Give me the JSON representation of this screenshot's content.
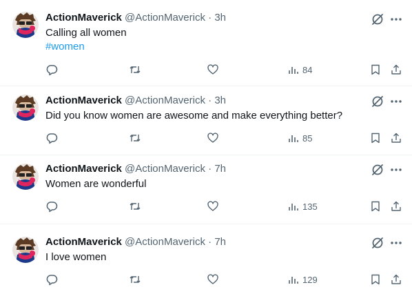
{
  "colors": {
    "link": "#1d9bf0",
    "secondary": "#536471",
    "text": "#0f1419",
    "divider": "#eff3f4"
  },
  "tweets": [
    {
      "name": "ActionMaverick",
      "handle": "@ActionMaverick",
      "sep": "·",
      "time": "3h",
      "text": "Calling all women",
      "hashtag": "#women",
      "views": "84"
    },
    {
      "name": "ActionMaverick",
      "handle": "@ActionMaverick",
      "sep": "·",
      "time": "3h",
      "text": "Did you know women are awesome and make everything better?",
      "views": "85"
    },
    {
      "name": "ActionMaverick",
      "handle": "@ActionMaverick",
      "sep": "·",
      "time": "7h",
      "text": "Women are wonderful",
      "views": "135"
    },
    {
      "name": "ActionMaverick",
      "handle": "@ActionMaverick",
      "sep": "·",
      "time": "7h",
      "text": "I love women",
      "views": "129"
    }
  ],
  "icons": {
    "reply": "reply-icon",
    "retweet": "retweet-icon",
    "like": "like-icon",
    "views": "views-icon",
    "bookmark": "bookmark-icon",
    "share": "share-icon",
    "grok": "grok-icon",
    "more": "more-icon"
  }
}
